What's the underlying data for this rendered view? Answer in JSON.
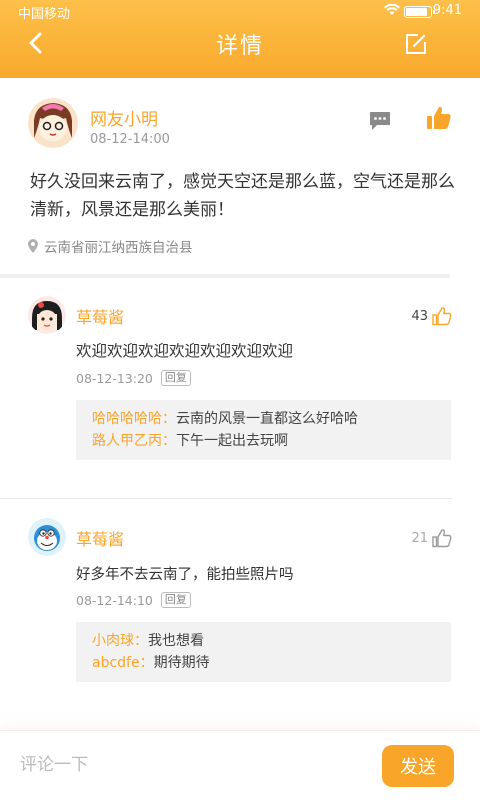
{
  "status_bar": {
    "carrier": "中国移动",
    "time": "9:41"
  },
  "nav": {
    "title": "详情"
  },
  "post": {
    "author": "网友小明",
    "time": "08-12-14:00",
    "content": "好久没回来云南了，感觉天空还是那么蓝，空气还是那么清新，风景还是那么美丽！",
    "location": "云南省丽江纳西族自治县"
  },
  "comments": [
    {
      "name": "草莓酱",
      "likes": "43",
      "text": "欢迎欢迎欢迎欢迎欢迎欢迎欢迎",
      "time": "08-12-13:20",
      "reply_label": "回复",
      "replies": [
        {
          "name": "哈哈哈哈哈：",
          "text": "云南的风景一直都这么好哈哈"
        },
        {
          "name": "路人甲乙丙：",
          "text": "下午一起出去玩啊"
        }
      ]
    },
    {
      "name": "草莓酱",
      "likes": "21",
      "text": "好多年不去云南了，能拍些照片吗",
      "time": "08-12-14:10",
      "reply_label": "回复",
      "replies": [
        {
          "name": "小肉球：",
          "text": "我也想看"
        },
        {
          "name": "abcdfe：",
          "text": "期待期待"
        }
      ]
    }
  ],
  "bottom_bar": {
    "input_placeholder": "评论一下",
    "send_label": "发送"
  },
  "colors": {
    "accent": "#f9a52a",
    "header_top": "#fdc04a",
    "header_bottom": "#f9a92c"
  },
  "icons": [
    "back-icon",
    "edit-icon",
    "message-icon",
    "thumbs-up-icon",
    "location-icon",
    "thumbs-up-outline-icon"
  ]
}
